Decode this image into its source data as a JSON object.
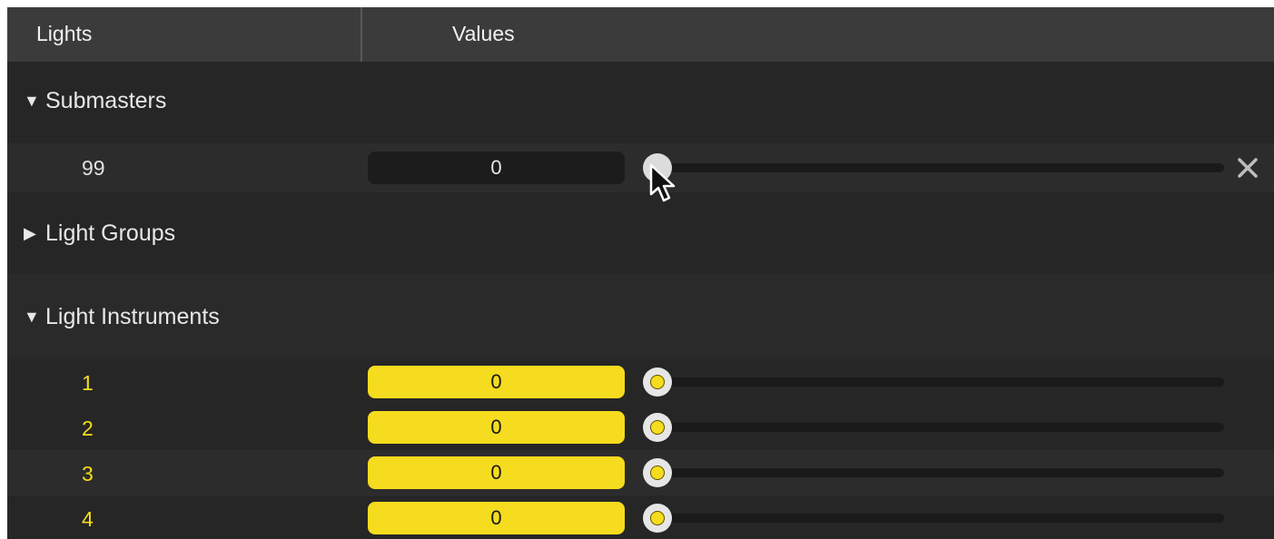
{
  "header": {
    "lights_label": "Lights",
    "values_label": "Values"
  },
  "submasters": {
    "title": "Submasters",
    "expanded": true,
    "items": [
      {
        "label": "99",
        "value": "0",
        "level": 0
      }
    ]
  },
  "light_groups": {
    "title": "Light Groups",
    "expanded": false
  },
  "light_instruments": {
    "title": "Light Instruments",
    "expanded": true,
    "items": [
      {
        "label": "1",
        "value": "0",
        "level": 0
      },
      {
        "label": "2",
        "value": "0",
        "level": 0
      },
      {
        "label": "3",
        "value": "0",
        "level": 0
      },
      {
        "label": "4",
        "value": "0",
        "level": 0
      }
    ]
  },
  "colors": {
    "panel_bg": "#262626",
    "header_bg": "#3b3b3b",
    "instrument_accent": "#f5dc1e",
    "submaster_field": "#1c1c1c"
  },
  "icons": {
    "expanded": "triangle-down-icon",
    "collapsed": "triangle-right-icon",
    "remove": "close-icon",
    "cursor": "mouse-pointer-icon"
  }
}
